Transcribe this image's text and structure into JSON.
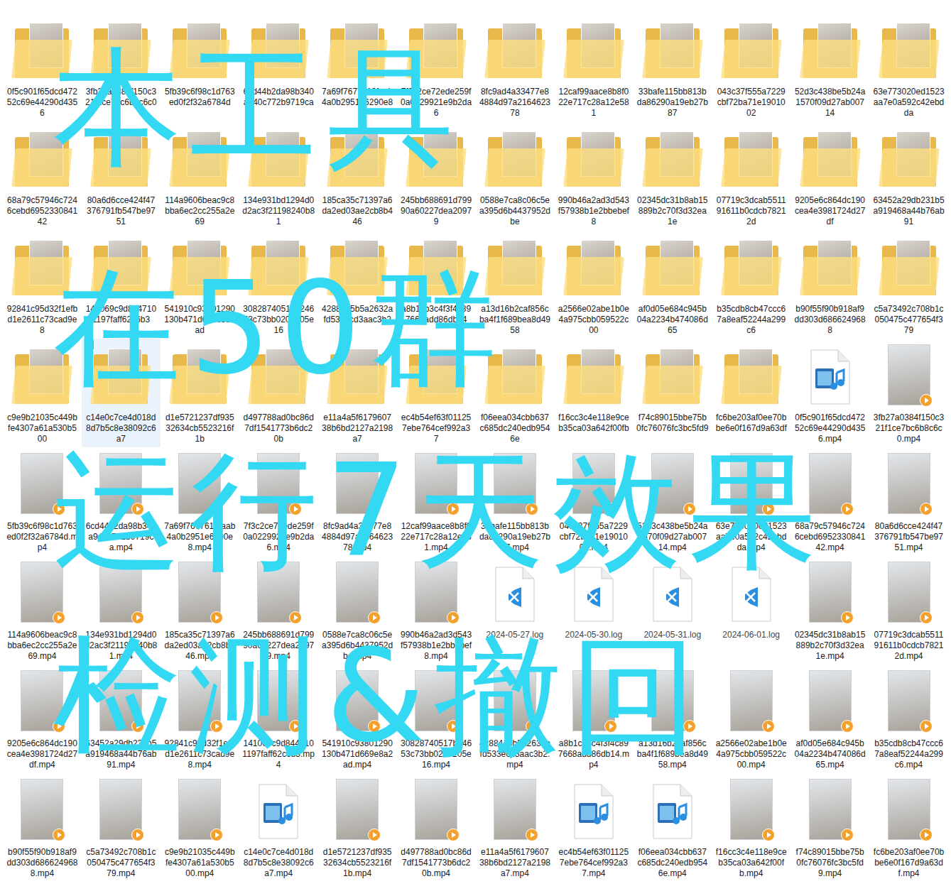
{
  "overlay": {
    "lines": [
      "本工具",
      "在50群",
      "运行7天效果",
      "检测&撤回"
    ]
  },
  "items": [
    {
      "kind": "folder",
      "name": "0f5c901f65dcd47252c69e44290d4356",
      "highlighted": false
    },
    {
      "kind": "folder",
      "name": "3fb27a0384f150c321f1ce7bc6b8c6c0",
      "highlighted": false
    },
    {
      "kind": "folder",
      "name": "5fb39c6f98c1d763ed0f2f32a6784d",
      "highlighted": false
    },
    {
      "kind": "folder",
      "name": "6cd44b2da98b340a940c772b9719ca",
      "highlighted": false
    },
    {
      "kind": "folder",
      "name": "7a69f7677612faab4a0b2951e6290e8",
      "highlighted": false
    },
    {
      "kind": "folder",
      "name": "7f3c2ce72ede259f0a0229921e9b2da6",
      "highlighted": false
    },
    {
      "kind": "folder",
      "name": "8fc9ad4a33477e84884d97a216462378",
      "highlighted": false
    },
    {
      "kind": "folder",
      "name": "12caf99aace8b8f022e717c28a12e581",
      "highlighted": false
    },
    {
      "kind": "folder",
      "name": "33bafe115bb813bda86290a19eb27b87",
      "highlighted": false
    },
    {
      "kind": "folder",
      "name": "043c37f555a7229cbf72ba71e1901002",
      "highlighted": false
    },
    {
      "kind": "folder",
      "name": "52d3c438be5b24a1570f09d27ab00714",
      "highlighted": false
    },
    {
      "kind": "folder",
      "name": "63e773020ed1523aa7e0a592c42ebdda",
      "highlighted": false
    },
    {
      "kind": "folder",
      "name": "68a79c57946c7246cebd695233084142",
      "highlighted": false
    },
    {
      "kind": "folder",
      "name": "80a6d6cce424f47376791fb547be9751",
      "highlighted": false
    },
    {
      "kind": "folder",
      "name": "114a9606beac9c8bba6ec2cc255a2e69",
      "highlighted": false
    },
    {
      "kind": "folder",
      "name": "134e931bd1294d0d2ac3f21198240b81",
      "highlighted": false
    },
    {
      "kind": "folder",
      "name": "185ca35c71397a6da2ed03ae2cb8b446",
      "highlighted": false
    },
    {
      "kind": "folder",
      "name": "245bb688691d79990a60227dea20979",
      "highlighted": false
    },
    {
      "kind": "folder",
      "name": "0588e7ca8c06c5ea395d6b4437952dbe",
      "highlighted": false
    },
    {
      "kind": "folder",
      "name": "990b46a2ad3d543f57938b1e2bbebef8",
      "highlighted": false
    },
    {
      "kind": "folder",
      "name": "02345dc31b8ab15889b2c70f3d32ea1e",
      "highlighted": false
    },
    {
      "kind": "folder",
      "name": "07719c3dcab551191611b0cdcb78212d",
      "highlighted": false
    },
    {
      "kind": "folder",
      "name": "9205e6c864dc190cea4e3981724d27df",
      "highlighted": false
    },
    {
      "kind": "folder",
      "name": "63452a29db231b5a919468a44b76ab91",
      "highlighted": false
    },
    {
      "kind": "folder",
      "name": "92841c95d32f1efbd1e2611c73cad9e8",
      "highlighted": false
    },
    {
      "kind": "folder",
      "name": "141069c9d8447101197faff62c6b3",
      "highlighted": false
    },
    {
      "kind": "folder",
      "name": "541910c93801290130b471d669e8a2ad",
      "highlighted": false
    },
    {
      "kind": "folder",
      "name": "30828740517b24653c73bb0209205e16",
      "highlighted": false
    },
    {
      "kind": "folder",
      "name": "4288445b5a2632afd533ecd3aac3b2",
      "highlighted": false
    },
    {
      "kind": "folder",
      "name": "a8b1cb3c4f3f4c897668add86db14",
      "highlighted": false
    },
    {
      "kind": "folder",
      "name": "a13d16b2caf856cba4f1f689bea8d4958",
      "highlighted": false
    },
    {
      "kind": "folder",
      "name": "a2566e02abe1b0e4a975cbb059522c00",
      "highlighted": false
    },
    {
      "kind": "folder",
      "name": "af0d05e684c945b04a2234b474086d65",
      "highlighted": false
    },
    {
      "kind": "folder",
      "name": "b35cdb8cb47ccc67a8eaf52244a299c6",
      "highlighted": false
    },
    {
      "kind": "folder",
      "name": "b90f55f90b918af9dd303d6866249688",
      "highlighted": false
    },
    {
      "kind": "folder",
      "name": "c5a73492c708b1c050475c477654f379",
      "highlighted": false
    },
    {
      "kind": "folder",
      "name": "c9e9b21035c449bfe4307a61a530b500",
      "highlighted": false
    },
    {
      "kind": "folder",
      "name": "c14e0c7ce4d018d8d7b5c8e38092c6a7",
      "highlighted": true
    },
    {
      "kind": "folder",
      "name": "d1e5721237df93532634cb5523216f1b",
      "highlighted": false
    },
    {
      "kind": "folder",
      "name": "d497788ad0bc86d7df1541773b6dc20b",
      "highlighted": false
    },
    {
      "kind": "folder",
      "name": "e11a4a5f617960738b6bd2127a2198a7",
      "highlighted": false
    },
    {
      "kind": "folder",
      "name": "ec4b54ef63f011257ebe764cef992a37",
      "highlighted": false
    },
    {
      "kind": "folder",
      "name": "f06eea034cbb637c685dc240edb9546e",
      "highlighted": false
    },
    {
      "kind": "folder",
      "name": "f16cc3c4e118e9ceb35ca03a642f00fb",
      "highlighted": false
    },
    {
      "kind": "folder",
      "name": "f74c89015bbe75b0fc76076fc3bc5fd9",
      "highlighted": false
    },
    {
      "kind": "folder",
      "name": "fc6be203af0ee70bbe6e0f167d9a63df",
      "highlighted": false
    },
    {
      "kind": "media",
      "name": "0f5c901f65dcd47252c69e44290d4356.mp4",
      "highlighted": false
    },
    {
      "kind": "video",
      "name": "3fb27a0384f150c321f1ce7bc6b8c6c0.mp4",
      "highlighted": false
    },
    {
      "kind": "video",
      "name": "5fb39c6f98c1d763ed0f2f32a6784d.mp4",
      "highlighted": false
    },
    {
      "kind": "video",
      "name": "6cd44b2da98b340a940c772b9719ca.mp4",
      "highlighted": false
    },
    {
      "kind": "video",
      "name": "7a69f7677612faab4a0b2951e6290e8.mp4",
      "highlighted": false
    },
    {
      "kind": "video",
      "name": "7f3c2ce72ede259f0a0229921e9b2da6.mp4",
      "highlighted": false
    },
    {
      "kind": "video",
      "name": "8fc9ad4a33477e84884d97a216462378.mp4",
      "highlighted": false
    },
    {
      "kind": "video",
      "name": "12caf99aace8b8f022e717c28a12e581.mp4",
      "highlighted": false
    },
    {
      "kind": "video",
      "name": "33bafe115bb813bda86290a19eb27b87.mp4",
      "highlighted": false
    },
    {
      "kind": "video",
      "name": "043c37f555a7229cbf72ba71e1901002.mp4",
      "highlighted": false
    },
    {
      "kind": "video",
      "name": "52d3c438be5b24a1570f09d27ab00714.mp4",
      "highlighted": false
    },
    {
      "kind": "video",
      "name": "63e773020ed1523aa7e0a592c42ebdda.mp4",
      "highlighted": false
    },
    {
      "kind": "video",
      "name": "68a79c57946c7246cebd695233084142.mp4",
      "highlighted": false
    },
    {
      "kind": "video",
      "name": "80a6d6cce424f47376791fb547be9751.mp4",
      "highlighted": false
    },
    {
      "kind": "video",
      "name": "114a9606beac9c8bba6ec2cc255a2e69.mp4",
      "highlighted": false
    },
    {
      "kind": "video",
      "name": "134e931bd1294d0d2ac3f21198240b81.mp4",
      "highlighted": false
    },
    {
      "kind": "video",
      "name": "185ca35c71397a6da2ed03ae2cb8b446.mp4",
      "highlighted": false
    },
    {
      "kind": "video",
      "name": "245bb688691d79990a60227dea20979.mp4",
      "highlighted": false
    },
    {
      "kind": "video",
      "name": "0588e7ca8c06c5ea395d6b4437952dbe.mp4",
      "highlighted": false
    },
    {
      "kind": "video",
      "name": "990b46a2ad3d543f57938b1e2bbebef8.mp4",
      "highlighted": false
    },
    {
      "kind": "log",
      "name": "2024-05-27.log",
      "highlighted": false
    },
    {
      "kind": "log",
      "name": "2024-05-30.log",
      "highlighted": false
    },
    {
      "kind": "log",
      "name": "2024-05-31.log",
      "highlighted": false
    },
    {
      "kind": "log",
      "name": "2024-06-01.log",
      "highlighted": false
    },
    {
      "kind": "video",
      "name": "02345dc31b8ab15889b2c70f3d32ea1e.mp4",
      "highlighted": false
    },
    {
      "kind": "video",
      "name": "07719c3dcab551191611b0cdcb78212d.mp4",
      "highlighted": false
    },
    {
      "kind": "video",
      "name": "9205e6c864dc190cea4e3981724d27df.mp4",
      "highlighted": false
    },
    {
      "kind": "video",
      "name": "63452a29db231b5a919468a44b76ab91.mp4",
      "highlighted": false
    },
    {
      "kind": "video",
      "name": "92841c95d32f1efbd1e2611c73cad9e8.mp4",
      "highlighted": false
    },
    {
      "kind": "video",
      "name": "141069c9d8447101197faff62c6b3.mp4",
      "highlighted": false
    },
    {
      "kind": "video",
      "name": "541910c93801290130b471d669e8a2ad.mp4",
      "highlighted": false
    },
    {
      "kind": "video",
      "name": "30828740517b24653c73bb0209205e16.mp4",
      "highlighted": false
    },
    {
      "kind": "video",
      "name": "4288445b5a2632afd533ecd3aac3b2.mp4",
      "highlighted": false
    },
    {
      "kind": "video",
      "name": "a8b1cb3c4f3f4c897668add86db14.mp4",
      "highlighted": false
    },
    {
      "kind": "video",
      "name": "a13d16b2caf856cba4f1f689bea8d4958.mp4",
      "highlighted": false
    },
    {
      "kind": "video",
      "name": "a2566e02abe1b0e4a975cbb059522c00.mp4",
      "highlighted": false
    },
    {
      "kind": "video",
      "name": "af0d05e684c945b04a2234b474086d65.mp4",
      "highlighted": false
    },
    {
      "kind": "video",
      "name": "b35cdb8cb47ccc67a8eaf52244a299c6.mp4",
      "highlighted": false
    },
    {
      "kind": "video",
      "name": "b90f55f90b918af9dd303d6866249688.mp4",
      "highlighted": false
    },
    {
      "kind": "video",
      "name": "c5a73492c708b1c050475c477654f379.mp4",
      "highlighted": false
    },
    {
      "kind": "video",
      "name": "c9e9b21035c449bfe4307a61a530b500.mp4",
      "highlighted": false
    },
    {
      "kind": "media",
      "name": "c14e0c7ce4d018d8d7b5c8e38092c6a7.mp4",
      "highlighted": false
    },
    {
      "kind": "video",
      "name": "d1e5721237df93532634cb5523216f1b.mp4",
      "highlighted": false
    },
    {
      "kind": "video",
      "name": "d497788ad0bc86d7df1541773b6dc20b.mp4",
      "highlighted": false
    },
    {
      "kind": "video",
      "name": "e11a4a5f617960738b6bd2127a2198a7.mp4",
      "highlighted": false
    },
    {
      "kind": "media",
      "name": "ec4b54ef63f011257ebe764cef992a37.mp4",
      "highlighted": false
    },
    {
      "kind": "media",
      "name": "f06eea034cbb637c685dc240edb9546e.mp4",
      "highlighted": false
    },
    {
      "kind": "video",
      "name": "f16cc3c4e118e9ceb35ca03a642f00fb.mp4",
      "highlighted": false
    },
    {
      "kind": "video",
      "name": "f74c89015bbe75b0fc76076fc3bc5fd9.mp4",
      "highlighted": false
    },
    {
      "kind": "video",
      "name": "fc6be203af0ee70bbe6e0f167d9a63df.mp4",
      "highlighted": false
    }
  ]
}
